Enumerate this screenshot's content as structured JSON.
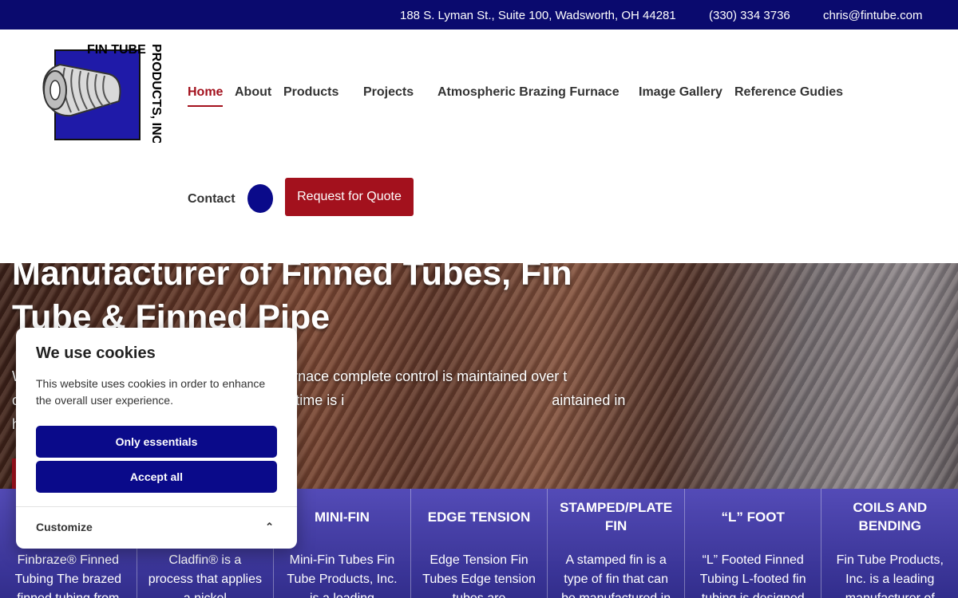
{
  "topbar": {
    "address": "188 S. Lyman St., Suite 100, Wadsworth, OH 44281",
    "phone": "(330) 334 3736",
    "email": "chris@fintube.com"
  },
  "brand": {
    "logo_text": "FIN TUBE PRODUCTS, INC.",
    "accent": "#a3111d",
    "navy": "#0a0a6e"
  },
  "nav": {
    "items": [
      "Home",
      "About",
      "Products",
      "Projects",
      "Atmospheric Brazing Furnace",
      "Image Gallery",
      "Reference Gudies",
      "Contact"
    ],
    "quote_label": "Request for Quote"
  },
  "hero": {
    "title": "Manufacturer of Finned Tubes, Fin Tube & Finned Pipe",
    "text": "W                                                    razing Furnace complete control is maintained over t                                                    out sourcing of our brazing your turn around time is i                                                    aintained in house."
  },
  "cards": [
    {
      "title": "",
      "text": "Finbraze® Finned Tubing The brazed finned tubing from"
    },
    {
      "title": "",
      "text": "Cladfin® is a process that applies a nickel"
    },
    {
      "title": "MINI-FIN",
      "text": "Mini-Fin Tubes Fin Tube Products, Inc. is a leading"
    },
    {
      "title": "EDGE TENSION",
      "text": "Edge Tension Fin Tubes Edge tension tubes are"
    },
    {
      "title": "STAMPED/PLATE FIN",
      "text": "A stamped fin is a type of fin that can be manufactured in"
    },
    {
      "title": "“L” FOOT",
      "text": "“L” Footed Finned Tubing L-footed fin tubing is designed"
    },
    {
      "title": "COILS AND BENDING",
      "text": "Fin Tube Products, Inc. is a leading manufacturer of"
    }
  ],
  "cookie": {
    "title": "We use cookies",
    "text": "This website uses cookies in order to enhance the overall user experience.",
    "only_essentials": "Only essentials",
    "accept_all": "Accept all",
    "customize": "Customize"
  }
}
